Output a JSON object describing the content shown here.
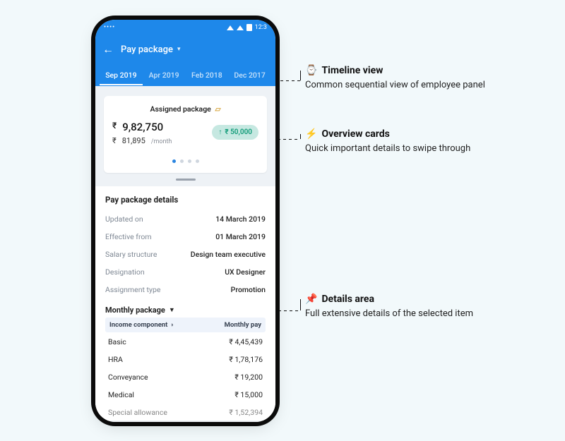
{
  "statusbar": {
    "time": "12:3"
  },
  "appbar": {
    "title": "Pay package"
  },
  "tabs": [
    "Sep 2019",
    "Apr 2019",
    "Feb 2018",
    "Dec 2017"
  ],
  "active_tab_index": 0,
  "card": {
    "title": "Assigned package",
    "amount": "9,82,750",
    "monthly": "81,895",
    "monthly_suffix": "/month",
    "delta": "₹ 50,000"
  },
  "details": {
    "heading": "Pay package details",
    "rows": [
      {
        "k": "Updated on",
        "v": "14 March 2019"
      },
      {
        "k": "Effective from",
        "v": "01 March 2019"
      },
      {
        "k": "Salary structure",
        "v": "Design team executive"
      },
      {
        "k": "Designation",
        "v": "UX Designer"
      },
      {
        "k": "Assignment type",
        "v": "Promotion"
      }
    ],
    "monthly_heading": "Monthly package",
    "col1": "Income component",
    "col2": "Monthly pay",
    "items": [
      {
        "k": "Basic",
        "v": "₹ 4,45,439"
      },
      {
        "k": "HRA",
        "v": "₹ 1,78,176"
      },
      {
        "k": "Conveyance",
        "v": "₹ 19,200"
      },
      {
        "k": "Medical",
        "v": "₹ 15,000"
      },
      {
        "k": "Special allowance",
        "v": "₹ 1,52,394"
      }
    ]
  },
  "annotations": {
    "a1": {
      "icon": "⌚",
      "title": "Timeline view",
      "desc": "Common sequential view of employee panel"
    },
    "a2": {
      "icon": "⚡",
      "title": "Overview cards",
      "desc": "Quick important details to swipe through"
    },
    "a3": {
      "icon": "📌",
      "title": "Details area",
      "desc": "Full extensive details of the selected item"
    }
  }
}
